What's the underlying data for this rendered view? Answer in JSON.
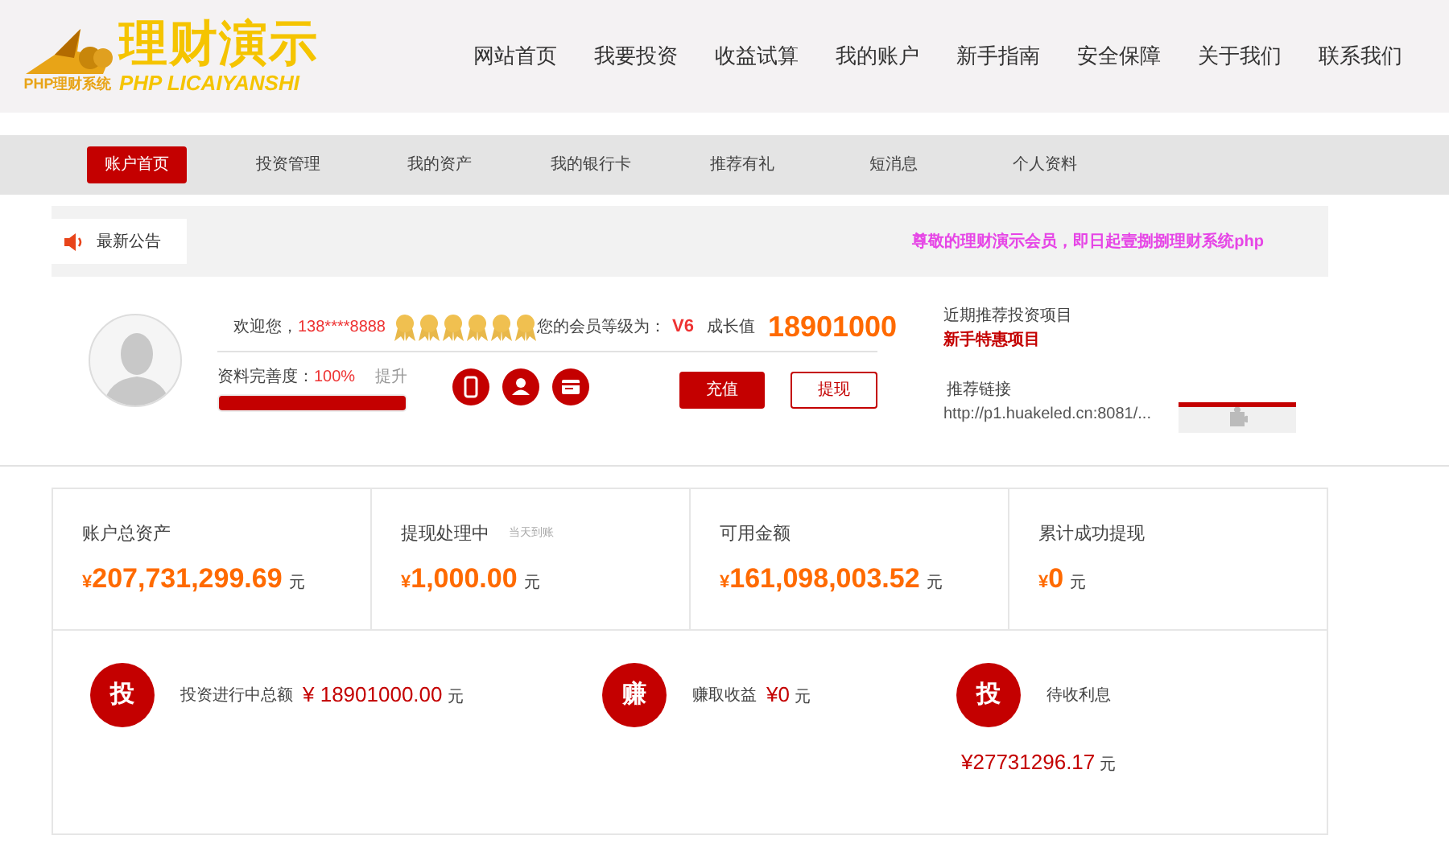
{
  "logo": {
    "title": "理财演示",
    "subtitle": "PHP LICAIYANSHI",
    "tagline": "PHP理财系统"
  },
  "nav": [
    {
      "label": "网站首页"
    },
    {
      "label": "我要投资"
    },
    {
      "label": "收益试算"
    },
    {
      "label": "我的账户"
    },
    {
      "label": "新手指南"
    },
    {
      "label": "安全保障"
    },
    {
      "label": "关于我们"
    },
    {
      "label": "联系我们"
    }
  ],
  "subnav": [
    {
      "label": "账户首页",
      "selected": true
    },
    {
      "label": "投资管理",
      "selected": false
    },
    {
      "label": "我的资产",
      "selected": false
    },
    {
      "label": "我的银行卡",
      "selected": false
    },
    {
      "label": "推荐有礼",
      "selected": false
    },
    {
      "label": "短消息",
      "selected": false
    },
    {
      "label": "个人资料",
      "selected": false
    }
  ],
  "notice": {
    "label": "最新公告",
    "text": "尊敬的理财演示会员，即日起壹捌捌理财系统php"
  },
  "profile": {
    "welcome": "欢迎您，",
    "phone": "138****8888",
    "stars": 6,
    "level_label": "您的会员等级为：",
    "level": "V6",
    "growth_label": "成长值",
    "growth": "18901000",
    "completeness_label": "资料完善度：",
    "completeness": "100%",
    "completeness_bar": {
      "level": 1
    },
    "improve": "提升",
    "recharge": "充值",
    "withdraw": "提现"
  },
  "recommend": {
    "title": "近期推荐投资项目",
    "project": "新手特惠项目",
    "link_label": "推荐链接",
    "link": "http://p1.huakeled.cn:8081/..."
  },
  "stats": [
    {
      "label": "账户总资产",
      "value": "207,731,299.69",
      "unit": "元"
    },
    {
      "label": "提现处理中",
      "note": "当天到账",
      "value": "1,000.00",
      "unit": "元"
    },
    {
      "label": "可用金额",
      "value": "161,098,003.52",
      "unit": "元"
    },
    {
      "label": "累计成功提现",
      "value": "0",
      "unit": "元"
    }
  ],
  "currency": "¥",
  "summary": [
    {
      "icon": "投",
      "label": "投资进行中总额",
      "value": "¥ 18901000.00",
      "unit": "元",
      "kind": "inline"
    },
    {
      "icon": "赚",
      "label": "赚取收益",
      "value": "¥0",
      "unit": "元",
      "kind": "inline"
    },
    {
      "icon": "投",
      "label": "待收利息",
      "value": "¥27731296.17",
      "unit": "元",
      "kind": "below"
    }
  ]
}
